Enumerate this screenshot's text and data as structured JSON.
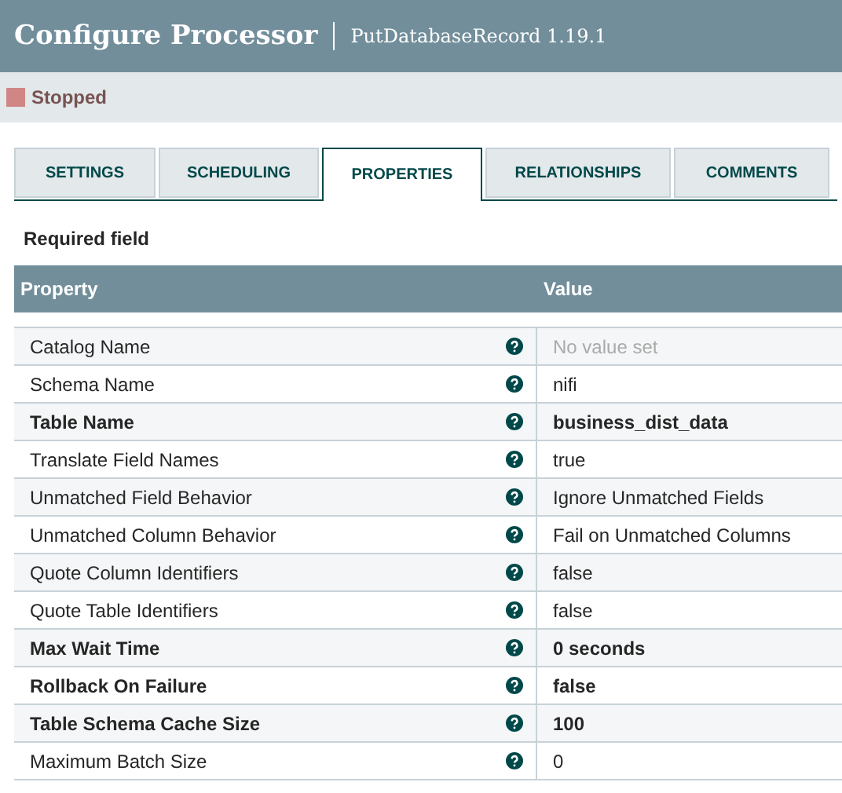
{
  "window": {
    "title": "Configure Processor",
    "subtitle": "PutDatabaseRecord 1.19.1"
  },
  "status": {
    "label": "Stopped",
    "color": "#d18686"
  },
  "tabs": [
    {
      "label": "SETTINGS",
      "selected": false
    },
    {
      "label": "SCHEDULING",
      "selected": false
    },
    {
      "label": "PROPERTIES",
      "selected": true
    },
    {
      "label": "RELATIONSHIPS",
      "selected": false
    },
    {
      "label": "COMMENTS",
      "selected": false
    }
  ],
  "legend": "Required field",
  "table": {
    "columns": [
      "Property",
      "Value"
    ],
    "rows": [
      {
        "property": "Catalog Name",
        "value": "No value set",
        "required": false,
        "value_set": false
      },
      {
        "property": "Schema Name",
        "value": "nifi",
        "required": false,
        "value_set": true
      },
      {
        "property": "Table Name",
        "value": "business_dist_data",
        "required": true,
        "value_set": true
      },
      {
        "property": "Translate Field Names",
        "value": "true",
        "required": false,
        "value_set": true
      },
      {
        "property": "Unmatched Field Behavior",
        "value": "Ignore Unmatched Fields",
        "required": false,
        "value_set": true
      },
      {
        "property": "Unmatched Column Behavior",
        "value": "Fail on Unmatched Columns",
        "required": false,
        "value_set": true
      },
      {
        "property": "Quote Column Identifiers",
        "value": "false",
        "required": false,
        "value_set": true
      },
      {
        "property": "Quote Table Identifiers",
        "value": "false",
        "required": false,
        "value_set": true
      },
      {
        "property": "Max Wait Time",
        "value": "0 seconds",
        "required": true,
        "value_set": true
      },
      {
        "property": "Rollback On Failure",
        "value": "false",
        "required": true,
        "value_set": true
      },
      {
        "property": "Table Schema Cache Size",
        "value": "100",
        "required": true,
        "value_set": true
      },
      {
        "property": "Maximum Batch Size",
        "value": "0",
        "required": false,
        "value_set": true
      }
    ]
  }
}
